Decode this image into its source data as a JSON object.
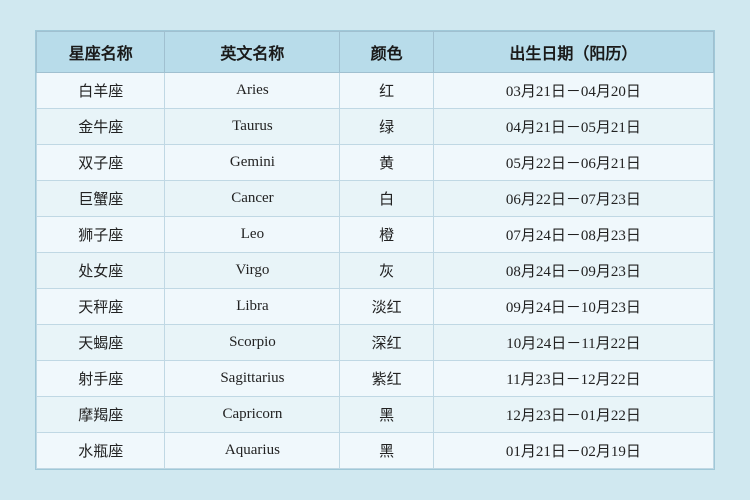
{
  "table": {
    "headers": [
      "星座名称",
      "英文名称",
      "颜色",
      "出生日期（阳历）"
    ],
    "rows": [
      {
        "cn": "白羊座",
        "en": "Aries",
        "color": "红",
        "date": "03月21日－04月20日"
      },
      {
        "cn": "金牛座",
        "en": "Taurus",
        "color": "绿",
        "date": "04月21日－05月21日"
      },
      {
        "cn": "双子座",
        "en": "Gemini",
        "color": "黄",
        "date": "05月22日－06月21日"
      },
      {
        "cn": "巨蟹座",
        "en": "Cancer",
        "color": "白",
        "date": "06月22日－07月23日"
      },
      {
        "cn": "狮子座",
        "en": "Leo",
        "color": "橙",
        "date": "07月24日－08月23日"
      },
      {
        "cn": "处女座",
        "en": "Virgo",
        "color": "灰",
        "date": "08月24日－09月23日"
      },
      {
        "cn": "天秤座",
        "en": "Libra",
        "color": "淡红",
        "date": "09月24日－10月23日"
      },
      {
        "cn": "天蝎座",
        "en": "Scorpio",
        "color": "深红",
        "date": "10月24日－11月22日"
      },
      {
        "cn": "射手座",
        "en": "Sagittarius",
        "color": "紫红",
        "date": "11月23日－12月22日"
      },
      {
        "cn": "摩羯座",
        "en": "Capricorn",
        "color": "黑",
        "date": "12月23日－01月22日"
      },
      {
        "cn": "水瓶座",
        "en": "Aquarius",
        "color": "黑",
        "date": "01月21日－02月19日"
      }
    ]
  }
}
